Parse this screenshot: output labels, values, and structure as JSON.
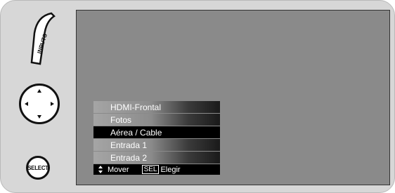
{
  "remote": {
    "inputs_label": "INPUTS",
    "select_label": "SELECT",
    "icons": [
      "up-arrow-icon",
      "down-arrow-icon",
      "left-arrow-icon",
      "right-arrow-icon"
    ]
  },
  "menu": {
    "items": [
      {
        "label": "HDMI-Frontal",
        "selected": false
      },
      {
        "label": "Fotos",
        "selected": false
      },
      {
        "label": "Aérea / Cable",
        "selected": true
      },
      {
        "label": "Entrada 1",
        "selected": false
      },
      {
        "label": "Entrada 2",
        "selected": false
      }
    ],
    "footer": {
      "move_label": "Mover",
      "sel_key": "SEL",
      "choose_label": "Elegir"
    }
  },
  "colors": {
    "panel": "#d7d7d7",
    "screen": "#8a8a8a",
    "selected": "#000000"
  }
}
